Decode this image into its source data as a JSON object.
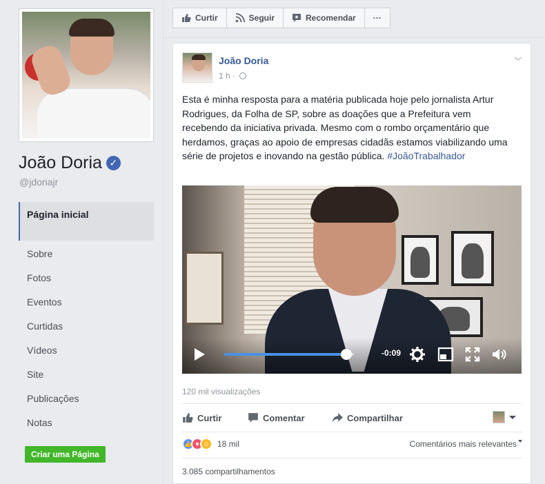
{
  "sidebar": {
    "page_name": "João Doria",
    "handle": "@jdoriajr",
    "nav": [
      {
        "label": "Página inicial",
        "active": true
      },
      {
        "label": "Sobre"
      },
      {
        "label": "Fotos"
      },
      {
        "label": "Eventos"
      },
      {
        "label": "Curtidas"
      },
      {
        "label": "Vídeos"
      },
      {
        "label": "Site"
      },
      {
        "label": "Publicações"
      },
      {
        "label": "Notas"
      }
    ],
    "create_page_label": "Criar uma Página"
  },
  "toolbar": {
    "like_label": "Curtir",
    "follow_label": "Seguir",
    "recommend_label": "Recomendar",
    "more_label": "···"
  },
  "post": {
    "author": "João Doria",
    "time": "1 h",
    "time_separator": "·",
    "text": "Esta é minha resposta para a matéria publicada hoje pelo jornalista Artur Rodrigues, da Folha de SP, sobre as doações que a Prefeitura vem recebendo da iniciativa privada. Mesmo com o rombo orçamentário que herdamos, graças ao apoio de empresas cidadãs estamos viabilizando uma série de projetos e inovando na gestão pública.",
    "hashtag": "#JoãoTrabalhador",
    "video": {
      "progress_fraction": 0.94,
      "time_remaining": "-0:09"
    },
    "views": "120 mil visualizações",
    "actions": {
      "like": "Curtir",
      "comment": "Comentar",
      "share": "Compartilhar"
    },
    "reactions_count": "18 mil",
    "sort_label": "Comentários mais relevantes",
    "shares": "3.085 compartilhamentos"
  },
  "colors": {
    "link": "#365899",
    "accent": "#4267b2",
    "create_button": "#42b72a",
    "video_progress": "#4a90e2"
  }
}
